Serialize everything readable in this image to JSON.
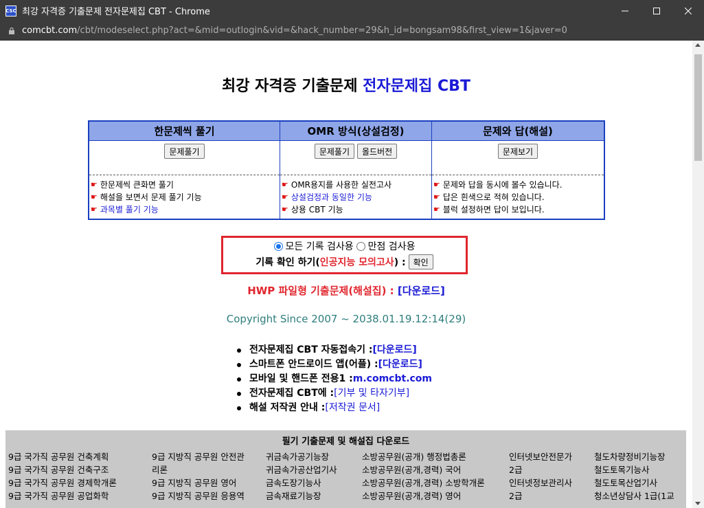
{
  "window": {
    "icon_text": "CSC",
    "title": "최강 자격증 기출문제 전자문제집 CBT - Chrome",
    "controls": [
      "minimize-icon",
      "maximize-icon",
      "close-icon"
    ]
  },
  "address": {
    "host": "comcbt.com",
    "path": "/cbt/modeselect.php?act=&mid=outlogin&vid=&hack_number=29&h_id=bongsam98&first_view=1&javer=0"
  },
  "header": {
    "title_main": "최강 자격증 기출문제 ",
    "title_highlight": "전자문제집 CBT"
  },
  "modes": [
    {
      "heading": "한문제씩 풀기",
      "buttons": [
        "문제풀기"
      ],
      "features": [
        {
          "text": "한문제씩 큰화면 풀기",
          "highlight": false
        },
        {
          "text": "해설을 보면서 문제 풀기 기능",
          "highlight": false
        },
        {
          "text": "과목별 풀기 기능",
          "highlight": true
        }
      ]
    },
    {
      "heading": "OMR 방식(상설검정)",
      "buttons": [
        "문제풀기",
        "올드버전"
      ],
      "features": [
        {
          "text": "OMR용지를 사용한 실전고사",
          "highlight": false
        },
        {
          "text": "상설검정과 동일한 기능",
          "highlight": true
        },
        {
          "text": "상용 CBT 기능",
          "highlight": false
        }
      ]
    },
    {
      "heading": "문제와 답(해설)",
      "buttons": [
        "문제보기"
      ],
      "features": [
        {
          "text": "문제와 답을 동시에 볼수 있습니다.",
          "highlight": false
        },
        {
          "text": "답은 흰색으로 적혀 있습니다.",
          "highlight": false
        },
        {
          "text": "블럭 설정하면 답이 보입니다.",
          "highlight": false
        }
      ]
    }
  ],
  "record_check": {
    "option_all": "모든 기록 검사용",
    "option_perfect": "만점 검사용",
    "selected": "option_all",
    "label_prefix": "기록 확인 하기(",
    "label_highlight": "인공지능 모의고사",
    "label_suffix": ") :",
    "button": "확인"
  },
  "hwp": {
    "label": "HWP 파일형 기출문제(해설집) : ",
    "link": "[다운로드]"
  },
  "copyright": "Copyright Since 2007 ~ 2038.01.19.12:14(29)",
  "links": [
    {
      "label": "전자문제집 CBT 자동접속기 : ",
      "link": "[다운로드]"
    },
    {
      "label": "스마트폰 안드로이드 앱(어플) : ",
      "link": "[다운로드]"
    },
    {
      "label": "모바일 및 핸드폰 전용1 : ",
      "link": "m.comcbt.com"
    },
    {
      "label": "전자문제집 CBT에 : ",
      "link": "[기부 및 타자기부]"
    },
    {
      "label": "해설 저작권 안내 : ",
      "link": "[저작권 문서]"
    }
  ],
  "downloads": {
    "title": "필기 기출문제 및 해설집 다운로드",
    "columns": [
      [
        "9급 국가직 공무원 건축계획",
        "9급 국가직 공무원 건축구조",
        "9급 국가직 공무원 경제학개론",
        "9급 국가직 공무원 공업화학"
      ],
      [
        "9급 지방직 공무원 안전관",
        "리론",
        "9급 지방직 공무원 영어",
        "9급 지방직 공무원 응용역"
      ],
      [
        "귀금속가공기능장",
        "귀금속가공산업기사",
        "금속도장기능사",
        "금속재료기능장"
      ],
      [
        "소방공무원(공개) 행정법총론",
        "소방공무원(공개,경력) 국어",
        "소방공무원(공개,경력) 소방학개론",
        "소방공무원(공개,경력) 영어"
      ],
      [
        "인터넷보안전문가",
        "2급",
        "인터넷정보관리사",
        "2급"
      ],
      [
        "철도차량정비기능장",
        "철도토목기능사",
        "철도토목산업기사",
        "청소년상담사 1급(1교"
      ]
    ]
  },
  "colors": {
    "accent_blue": "#1a1ad6",
    "table_border": "#1a3fbf",
    "table_header": "#8fa6e8",
    "highlight_red": "#e0262e",
    "copyright_teal": "#2e7d7d"
  }
}
